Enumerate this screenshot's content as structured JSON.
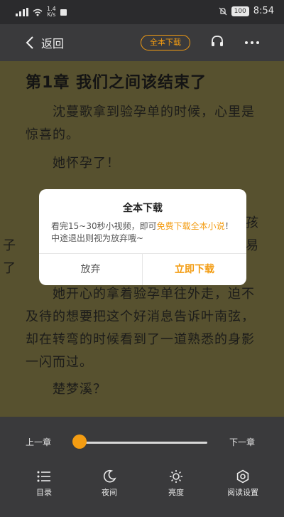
{
  "statusbar": {
    "net_speed": "1.4",
    "net_unit": "K/s",
    "battery": "100",
    "time": "8:54"
  },
  "topbar": {
    "back_label": "返回",
    "download_badge": "全本下载"
  },
  "reader": {
    "chapter_title": "第1章 我们之间该结束了",
    "para1": "沈蔓歌拿到验孕单的时候，心里是惊喜的。",
    "para2": "她怀孕了！",
    "para3_partial_a": "孩",
    "para3_partial_b": "子",
    "para3_partial_c": "易",
    "para3_partial_d": "了",
    "para4": "她开心的拿着验孕单往外走，迫不及待的想要把这个好消息告诉叶南弦，却在转弯的时候看到了一道熟悉的身影一闪而过。",
    "para5": "楚梦溪？"
  },
  "dialog": {
    "title": "全本下载",
    "msg_prefix": "看完15~30秒小视频，即可",
    "msg_highlight": "免费下载全本小说",
    "msg_suffix": "！中途退出则视为放弃哦~",
    "cancel_label": "放弃",
    "confirm_label": "立即下载"
  },
  "bottom": {
    "prev_label": "上一章",
    "next_label": "下一章",
    "progress_fraction": 0.0,
    "tools": [
      {
        "label": "目录",
        "icon": "list-icon"
      },
      {
        "label": "夜间",
        "icon": "moon-icon"
      },
      {
        "label": "亮度",
        "icon": "brightness-icon"
      },
      {
        "label": "阅读设置",
        "icon": "settings-icon"
      }
    ]
  },
  "colors": {
    "accent": "#f39c12",
    "page_bg": "#57512f",
    "bar_bg": "#3a3a3c"
  }
}
